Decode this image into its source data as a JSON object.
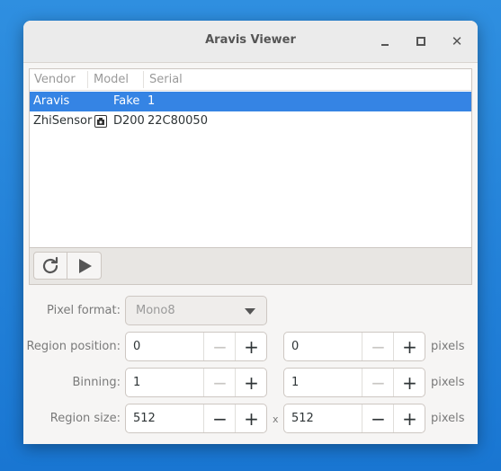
{
  "window": {
    "title": "Aravis Viewer"
  },
  "camera_list": {
    "columns": [
      "Vendor",
      "Model",
      "Serial"
    ],
    "rows": [
      {
        "vendor": "Aravis",
        "model": "Fake",
        "serial": "1",
        "selected": true
      },
      {
        "vendor": "ZhiSensor",
        "model": "D200",
        "serial": "22C80050",
        "selected": false,
        "icon": "camera-device-icon"
      }
    ]
  },
  "toolbar": {
    "refresh_icon": "refresh-icon",
    "play_icon": "play-icon"
  },
  "settings": {
    "pixel_format": {
      "label": "Pixel format:",
      "value": "Mono8"
    },
    "region_position": {
      "label": "Region position:",
      "x": "0",
      "y": "0",
      "unit": "pixels"
    },
    "binning": {
      "label": "Binning:",
      "x": "1",
      "y": "1",
      "unit": "pixels"
    },
    "region_size": {
      "label": "Region size:",
      "x": "512",
      "separator": "x",
      "y": "512",
      "unit": "pixels"
    }
  },
  "colors": {
    "selection": "#3584e4",
    "desktop": "#1976d2"
  }
}
